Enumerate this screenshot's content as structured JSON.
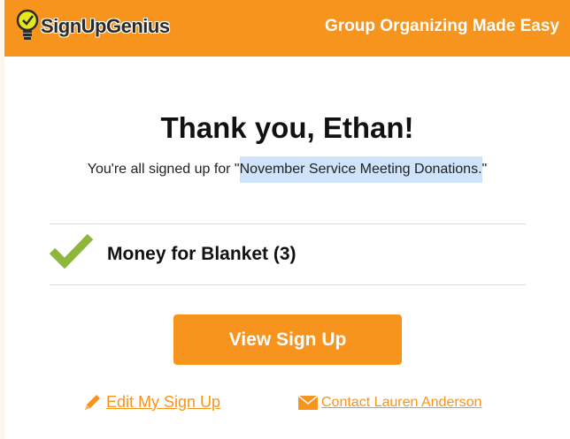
{
  "header": {
    "logo_text": "SignUpGenius",
    "tagline": "Group Organizing Made Easy"
  },
  "confirmation": {
    "title": "Thank you, Ethan!",
    "signed_prefix": "You're all signed up for \"",
    "event_name": "November Service Meeting Donations.",
    "signed_suffix": "\""
  },
  "item": {
    "label": "Money for Blanket (3)"
  },
  "buttons": {
    "view_label": "View Sign Up"
  },
  "links": {
    "edit_label": " Edit My Sign Up",
    "contact_label": " Contact Lauren Anderson"
  },
  "colors": {
    "brand_orange": "#f7941d",
    "check_green": "#8cb63c",
    "highlight": "#cfe3fb"
  },
  "icons": [
    "lightbulb-logo-icon",
    "checkmark-icon",
    "pencil-icon",
    "envelope-icon"
  ]
}
